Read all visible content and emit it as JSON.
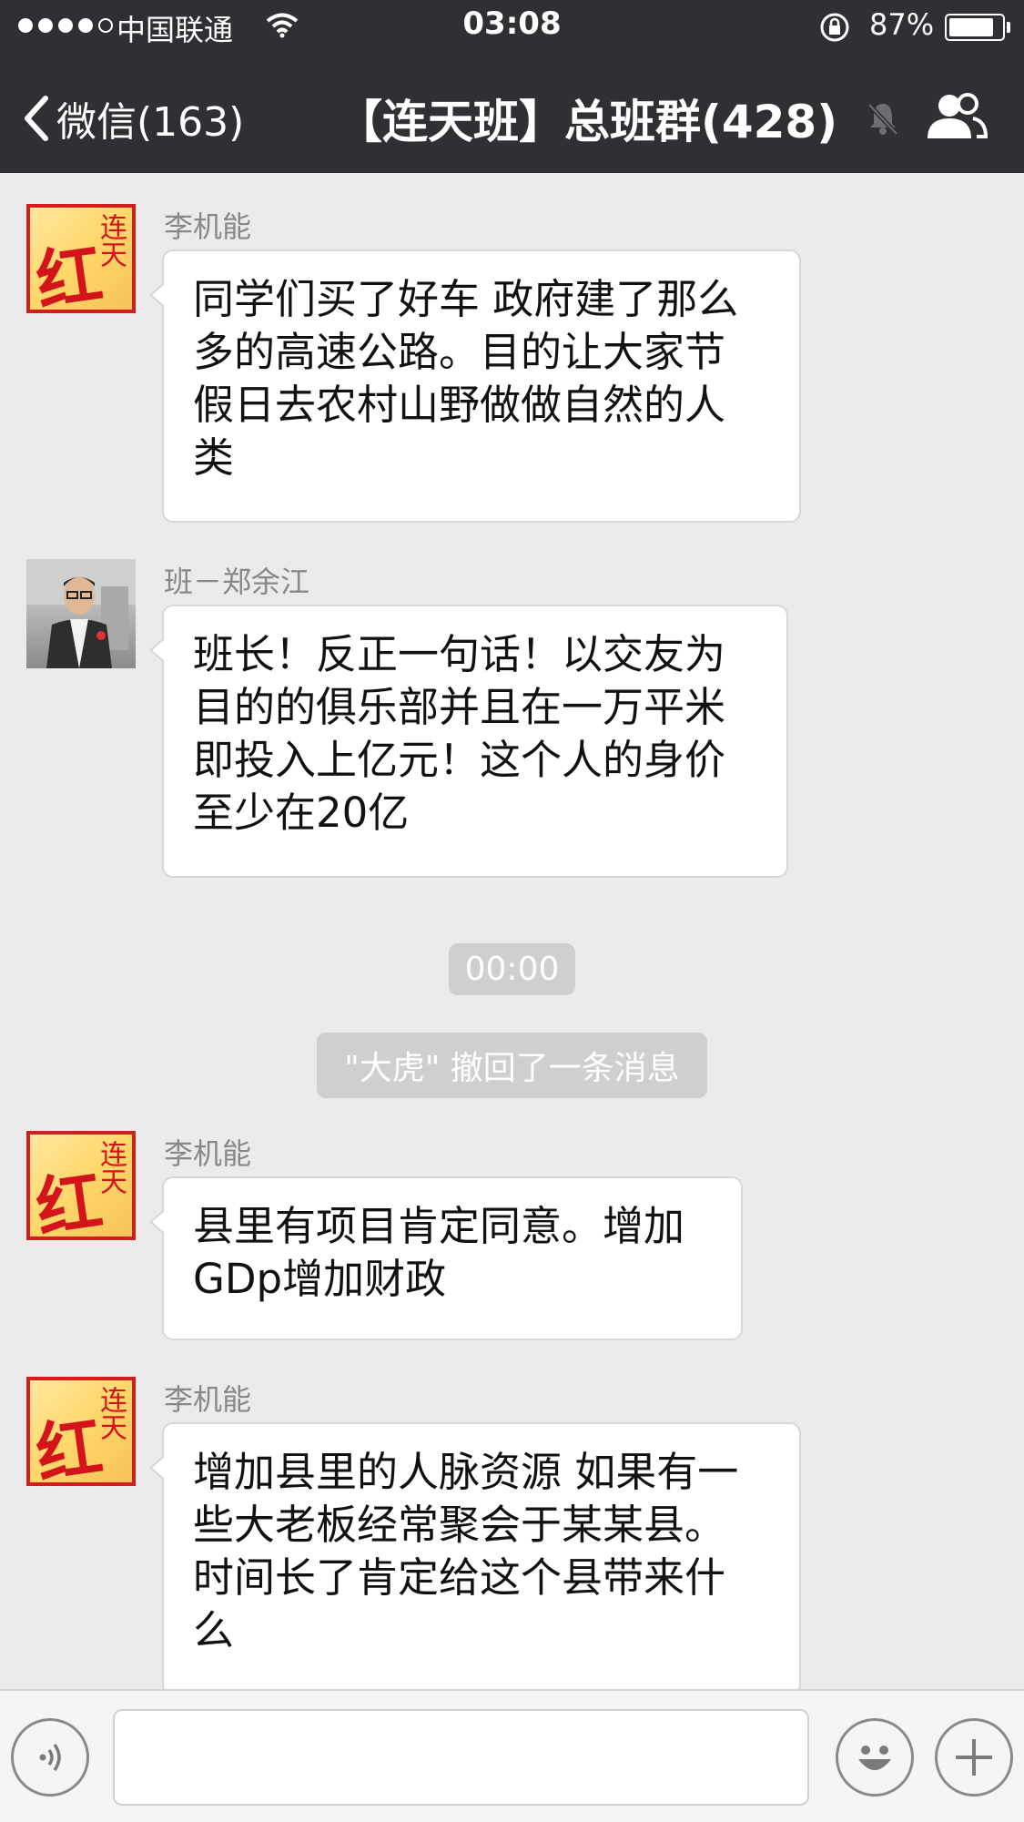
{
  "status_bar": {
    "carrier": "中国联通",
    "time": "03:08",
    "battery": "87%",
    "battery_level": 0.87
  },
  "nav": {
    "back_label": "微信(163)",
    "title": "【连天班】总班群(428)"
  },
  "messages": [
    {
      "sender": "李机能",
      "avatar": "hong-liantian-logo",
      "logo_main": "红",
      "logo_side": "连天",
      "lines": [
        "同学们买了好车 政府建了那么",
        "多的高速公路。目的让大家节",
        "假日去农村山野做做自然的人",
        "类"
      ]
    },
    {
      "sender": "班－郑余江",
      "avatar": "man-photo",
      "lines": [
        "班长！反正一句话！以交友为",
        "目的的俱乐部并且在一万平米",
        "即投入上亿元！这个人的身价",
        "至少在20亿"
      ]
    },
    {
      "sender": "李机能",
      "avatar": "hong-liantian-logo",
      "logo_main": "红",
      "logo_side": "连天",
      "lines": [
        "县里有项目肯定同意。增加",
        "GDp增加财政"
      ]
    },
    {
      "sender": "李机能",
      "avatar": "hong-liantian-logo",
      "logo_main": "红",
      "logo_side": "连天",
      "lines": [
        "增加县里的人脉资源 如果有一",
        "些大老板经常聚会于某某县。",
        "时间长了肯定给这个县带来什",
        "么"
      ]
    }
  ],
  "system": {
    "timestamp": "00:00",
    "recall_notice": "\"大虎\" 撤回了一条消息"
  },
  "colors": {
    "nav_bg": "#2f3033",
    "chat_bg": "#ebebeb",
    "bubble_bg": "#ffffff",
    "logo_red": "#d3141b"
  }
}
